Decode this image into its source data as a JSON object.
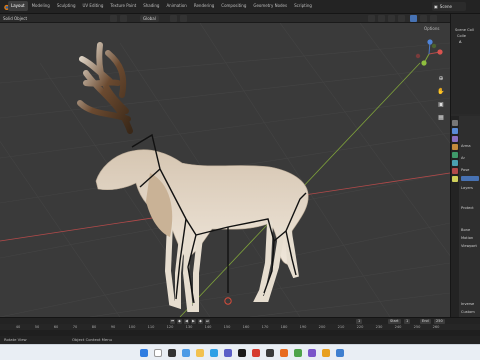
{
  "menu": {
    "workspace_tabs": [
      "Layout",
      "Modeling",
      "Sculpting",
      "UV Editing",
      "Texture Paint",
      "Shading",
      "Animation",
      "Rendering",
      "Compositing",
      "Geometry Nodes",
      "Scripting"
    ],
    "active_tab": "Layout",
    "scene_name": "Scene"
  },
  "viewport_header": {
    "mode_label": "Solid",
    "object_menu": "Object",
    "orientation": "Global",
    "options_label": "Options"
  },
  "outliner": {
    "rows": [
      "Scene Coll",
      "Colle",
      "A"
    ]
  },
  "properties": {
    "labels": [
      "Arma",
      "Ar",
      "Pose",
      "Layers",
      "Protect",
      "Bone",
      "Motion",
      "Viewport",
      "Inverse",
      "Custom"
    ]
  },
  "timeline": {
    "start_label": "Start",
    "start_value": "1",
    "end_label": "End",
    "end_value": "250",
    "current_frame": "1",
    "ruler_ticks": [
      "40",
      "50",
      "60",
      "70",
      "80",
      "90",
      "100",
      "110",
      "120",
      "130",
      "140",
      "150",
      "160",
      "170",
      "180",
      "190",
      "200",
      "210",
      "220",
      "230",
      "240",
      "250",
      "260"
    ]
  },
  "status_bar": {
    "left_hint": "Rotate View",
    "middle_hint": "Object Context Menu"
  },
  "colors": {
    "accent": "#e87d0d",
    "selection": "#4772b3",
    "x_axis": "#b54a4a",
    "y_axis": "#7fa33a"
  }
}
